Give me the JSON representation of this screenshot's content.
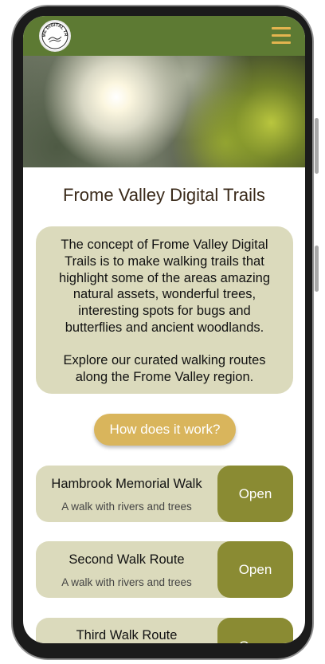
{
  "app": {
    "logo_text": "FROME DIGITAL TRAILS",
    "menu_icon": "hamburger-menu-icon",
    "accent": "#5d7a33",
    "button_color": "#d9b55c"
  },
  "page": {
    "title": "Frome Valley Digital Trails",
    "intro_p1": "The concept of Frome Valley Digital Trails is to make walking trails that highlight some of the areas amazing natural assets, wonderful trees, interesting spots for bugs and butterflies and ancient woodlands.",
    "intro_p2": "Explore our curated walking routes along the Frome Valley region.",
    "cta_label": "How does it work?"
  },
  "walks": [
    {
      "title": "Hambrook Memorial Walk",
      "subtitle": "A walk with rivers and trees",
      "button": "Open"
    },
    {
      "title": "Second Walk Route",
      "subtitle": "A walk with rivers and trees",
      "button": "Open"
    },
    {
      "title": "Third Walk Route",
      "subtitle": "",
      "button": "Open"
    }
  ]
}
